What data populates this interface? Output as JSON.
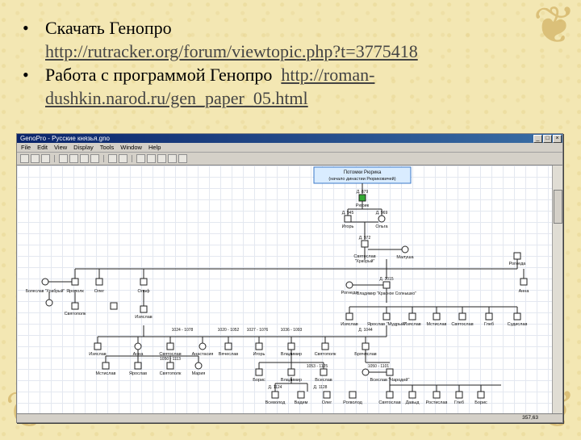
{
  "slide": {
    "bullets": [
      {
        "text": "Скачать Генопро",
        "link": "http://rutracker.org/forum/viewtopic.php?t=3775418"
      },
      {
        "text": "Работа с программой  Генопро",
        "link_part1": "http://roman-",
        "link_part2": "dushkin.narod.ru/gen_paper_05.html"
      }
    ]
  },
  "app": {
    "title": "GenoPro - Русские князья.gno",
    "menu": [
      "File",
      "Edit",
      "View",
      "Display",
      "Tools",
      "Window",
      "Help"
    ],
    "status": "357,63"
  },
  "tree": {
    "header": {
      "line1": "Потомки Рюрика",
      "line2": "(начало династии Рюриковичей)"
    },
    "root": {
      "dates": "Д. 879",
      "name": "Рюрик"
    },
    "gen1": [
      {
        "dates": "Д. 945",
        "name": "Игорь"
      },
      {
        "dates": "Д. 969",
        "name": "Ольга"
      }
    ],
    "gen2": {
      "dates": "Д. 972",
      "name": "Святослав",
      "sub": "\"Храбрый\"",
      "wife": "Малуша"
    },
    "gen3": [
      {
        "name": "Болеслав \"Храбрый\""
      },
      {
        "name": "Ярополк"
      },
      {
        "name": "Олег"
      },
      {
        "name": "Олаф"
      },
      {
        "name": "Рогнеда"
      },
      {
        "dates": "Д. 1015",
        "name": "Владимир \"Красное Солнышко\""
      },
      {
        "name": "Анна"
      },
      {
        "name": "Рогнеда"
      }
    ],
    "gen4": [
      {
        "name": "Святополк"
      },
      {
        "name": "Изяслав"
      },
      {
        "name": "Ярослав \"Мудрый\""
      },
      {
        "name": "Изяслав"
      },
      {
        "name": "Мстислав"
      },
      {
        "name": "Святослав"
      },
      {
        "name": "Глеб"
      },
      {
        "name": "Судислав"
      }
    ],
    "gen5_dates": [
      "1024 - 1078",
      "1020 - 1052",
      "1027 - 1076",
      "1036 - 1093",
      "Д. 1044"
    ],
    "gen5": [
      {
        "name": "Изяслав"
      },
      {
        "name": "Анна"
      },
      {
        "name": "Святослав"
      },
      {
        "name": "Анастасия"
      },
      {
        "name": "Вячеслав"
      },
      {
        "name": "Игорь"
      },
      {
        "name": "Владимир"
      },
      {
        "name": "Святополк"
      },
      {
        "name": "Брячислав"
      }
    ],
    "gen6_dates": [
      "1050 - 1113",
      "1053 - 1125",
      "1050 - 1101"
    ],
    "gen6": [
      {
        "name": "Мстислав"
      },
      {
        "name": "Ярослав"
      },
      {
        "name": "Святополк"
      },
      {
        "name": "Мария"
      },
      {
        "name": "Борис"
      },
      {
        "name": "Владимир"
      },
      {
        "name": "Всеслав"
      },
      {
        "name": "Всеслав \"Чародей\""
      }
    ],
    "gen7_dates": [
      "Д. 1124",
      "Д. 1128"
    ],
    "gen7": [
      {
        "name": "Всеволод"
      },
      {
        "name": "Вадим"
      },
      {
        "name": "Олег"
      },
      {
        "name": "Рогволод"
      },
      {
        "name": "Святослав"
      },
      {
        "name": "Давыд"
      },
      {
        "name": "Ростислав"
      },
      {
        "name": "Глеб"
      },
      {
        "name": "Борис"
      }
    ]
  }
}
